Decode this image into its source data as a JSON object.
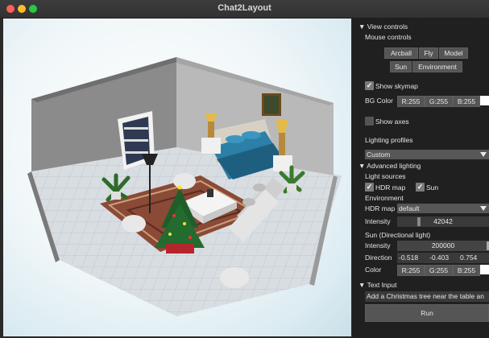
{
  "window": {
    "title": "Chat2Layout"
  },
  "panel": {
    "view_controls": {
      "header": "▼ View controls",
      "mouse_controls_label": "Mouse controls",
      "buttons": {
        "arcball": "Arcball",
        "fly": "Fly",
        "model": "Model",
        "sun": "Sun",
        "environment": "Environment"
      },
      "show_skymap": {
        "label": "Show skymap",
        "checked": true
      },
      "bg_color": {
        "label": "BG Color",
        "r": "R:255",
        "g": "G:255",
        "b": "B:255",
        "swatch": "#ffffff"
      },
      "show_axes": {
        "label": "Show axes",
        "checked": false
      },
      "lighting_profiles_label": "Lighting profiles",
      "lighting_profile_value": "Custom"
    },
    "advanced_lighting": {
      "header": "▼ Advanced lighting",
      "light_sources_label": "Light sources",
      "hdr_map_checkbox": {
        "label": "HDR map",
        "checked": true
      },
      "sun_checkbox": {
        "label": "Sun",
        "checked": true
      },
      "environment_label": "Environment",
      "hdr_map_label": "HDR map",
      "hdr_map_value": "default",
      "intensity_label": "Intensity",
      "intensity_value": "42042",
      "sun_section_label": "Sun (Directional light)",
      "sun_intensity_label": "Intensity",
      "sun_intensity_value": "200000",
      "direction_label": "Direction",
      "direction_values": [
        "-0.518",
        "-0.403",
        "0.754"
      ],
      "color_label": "Color",
      "color": {
        "r": "R:255",
        "g": "G:255",
        "b": "B:255",
        "swatch": "#ffffff"
      }
    },
    "text_input": {
      "header": "▼ Text Input",
      "value": "Add a Christmas tree near the table an",
      "run_label": "Run"
    }
  },
  "colors": {
    "close": "#fe5f57",
    "minimize": "#febc2e",
    "maximize": "#28c840",
    "panel_bg": "#202020",
    "button": "#555555"
  }
}
